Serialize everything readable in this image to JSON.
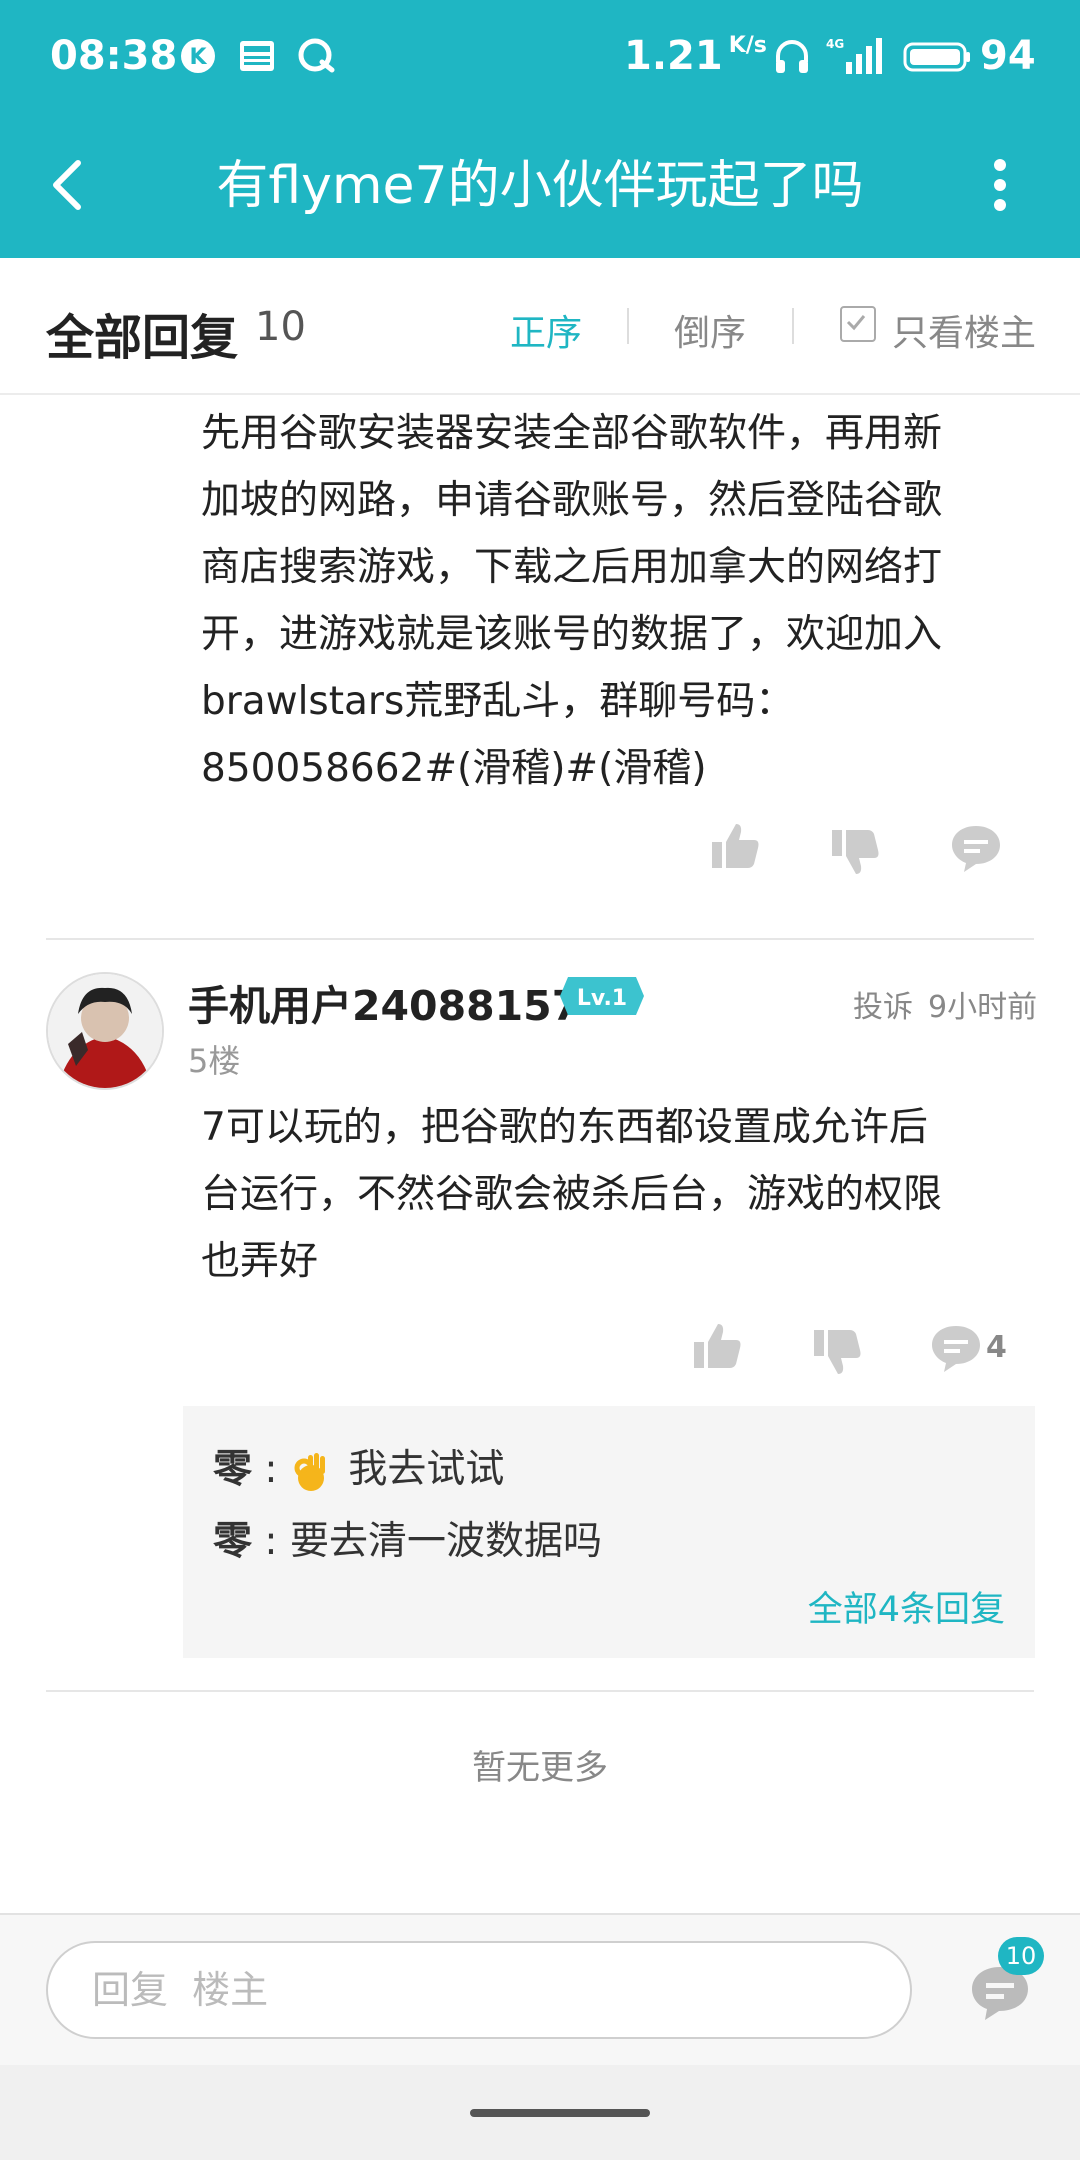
{
  "status_bar": {
    "time": "08:38",
    "speed": "1.21",
    "speed_unit": "K/s",
    "battery": "94",
    "icons": [
      "k-app-icon",
      "news-icon",
      "q-app-icon",
      "headphones-icon",
      "4g-signal-icon",
      "battery-icon"
    ]
  },
  "header": {
    "title": "有flyme7的小伙伴玩起了吗"
  },
  "sort_bar": {
    "label": "全部回复",
    "count": "10",
    "asc": "正序",
    "desc": "倒序",
    "owner_only": "只看楼主"
  },
  "post_prev": {
    "lines": [
      "先用谷歌安装器安装全部谷歌软件，再用新",
      "加坡的网路，申请谷歌账号，然后登陆谷歌",
      "商店搜索游戏，下载之后用加拿大的网络打",
      "开，进游戏就是该账号的数据了，欢迎加入",
      "brawlstars荒野乱斗，群聊号码：",
      "850058662#(滑稽)#(滑稽)"
    ]
  },
  "post": {
    "username": "手机用户24088157",
    "level": "Lv.1",
    "report": "投诉",
    "time_ago": "9小时前",
    "floor": "5楼",
    "lines": [
      "7可以玩的，把谷歌的东西都设置成允许后",
      "台运行，不然谷歌会被杀后台，游戏的权限",
      "也弄好"
    ],
    "comment_count": "4",
    "replies": [
      {
        "author": "零",
        "sep": ":",
        "text": "我去试试",
        "emoji": "ok-hand-emoji"
      },
      {
        "author": "零",
        "sep": ":",
        "text": "要去清一波数据吗"
      }
    ],
    "all_replies": "全部4条回复"
  },
  "no_more": "暂无更多",
  "bottom_bar": {
    "placeholder": "回复  楼主",
    "badge": "10"
  },
  "colors": {
    "accent": "#1fb6c3",
    "text": "#222222",
    "muted": "#888888"
  }
}
